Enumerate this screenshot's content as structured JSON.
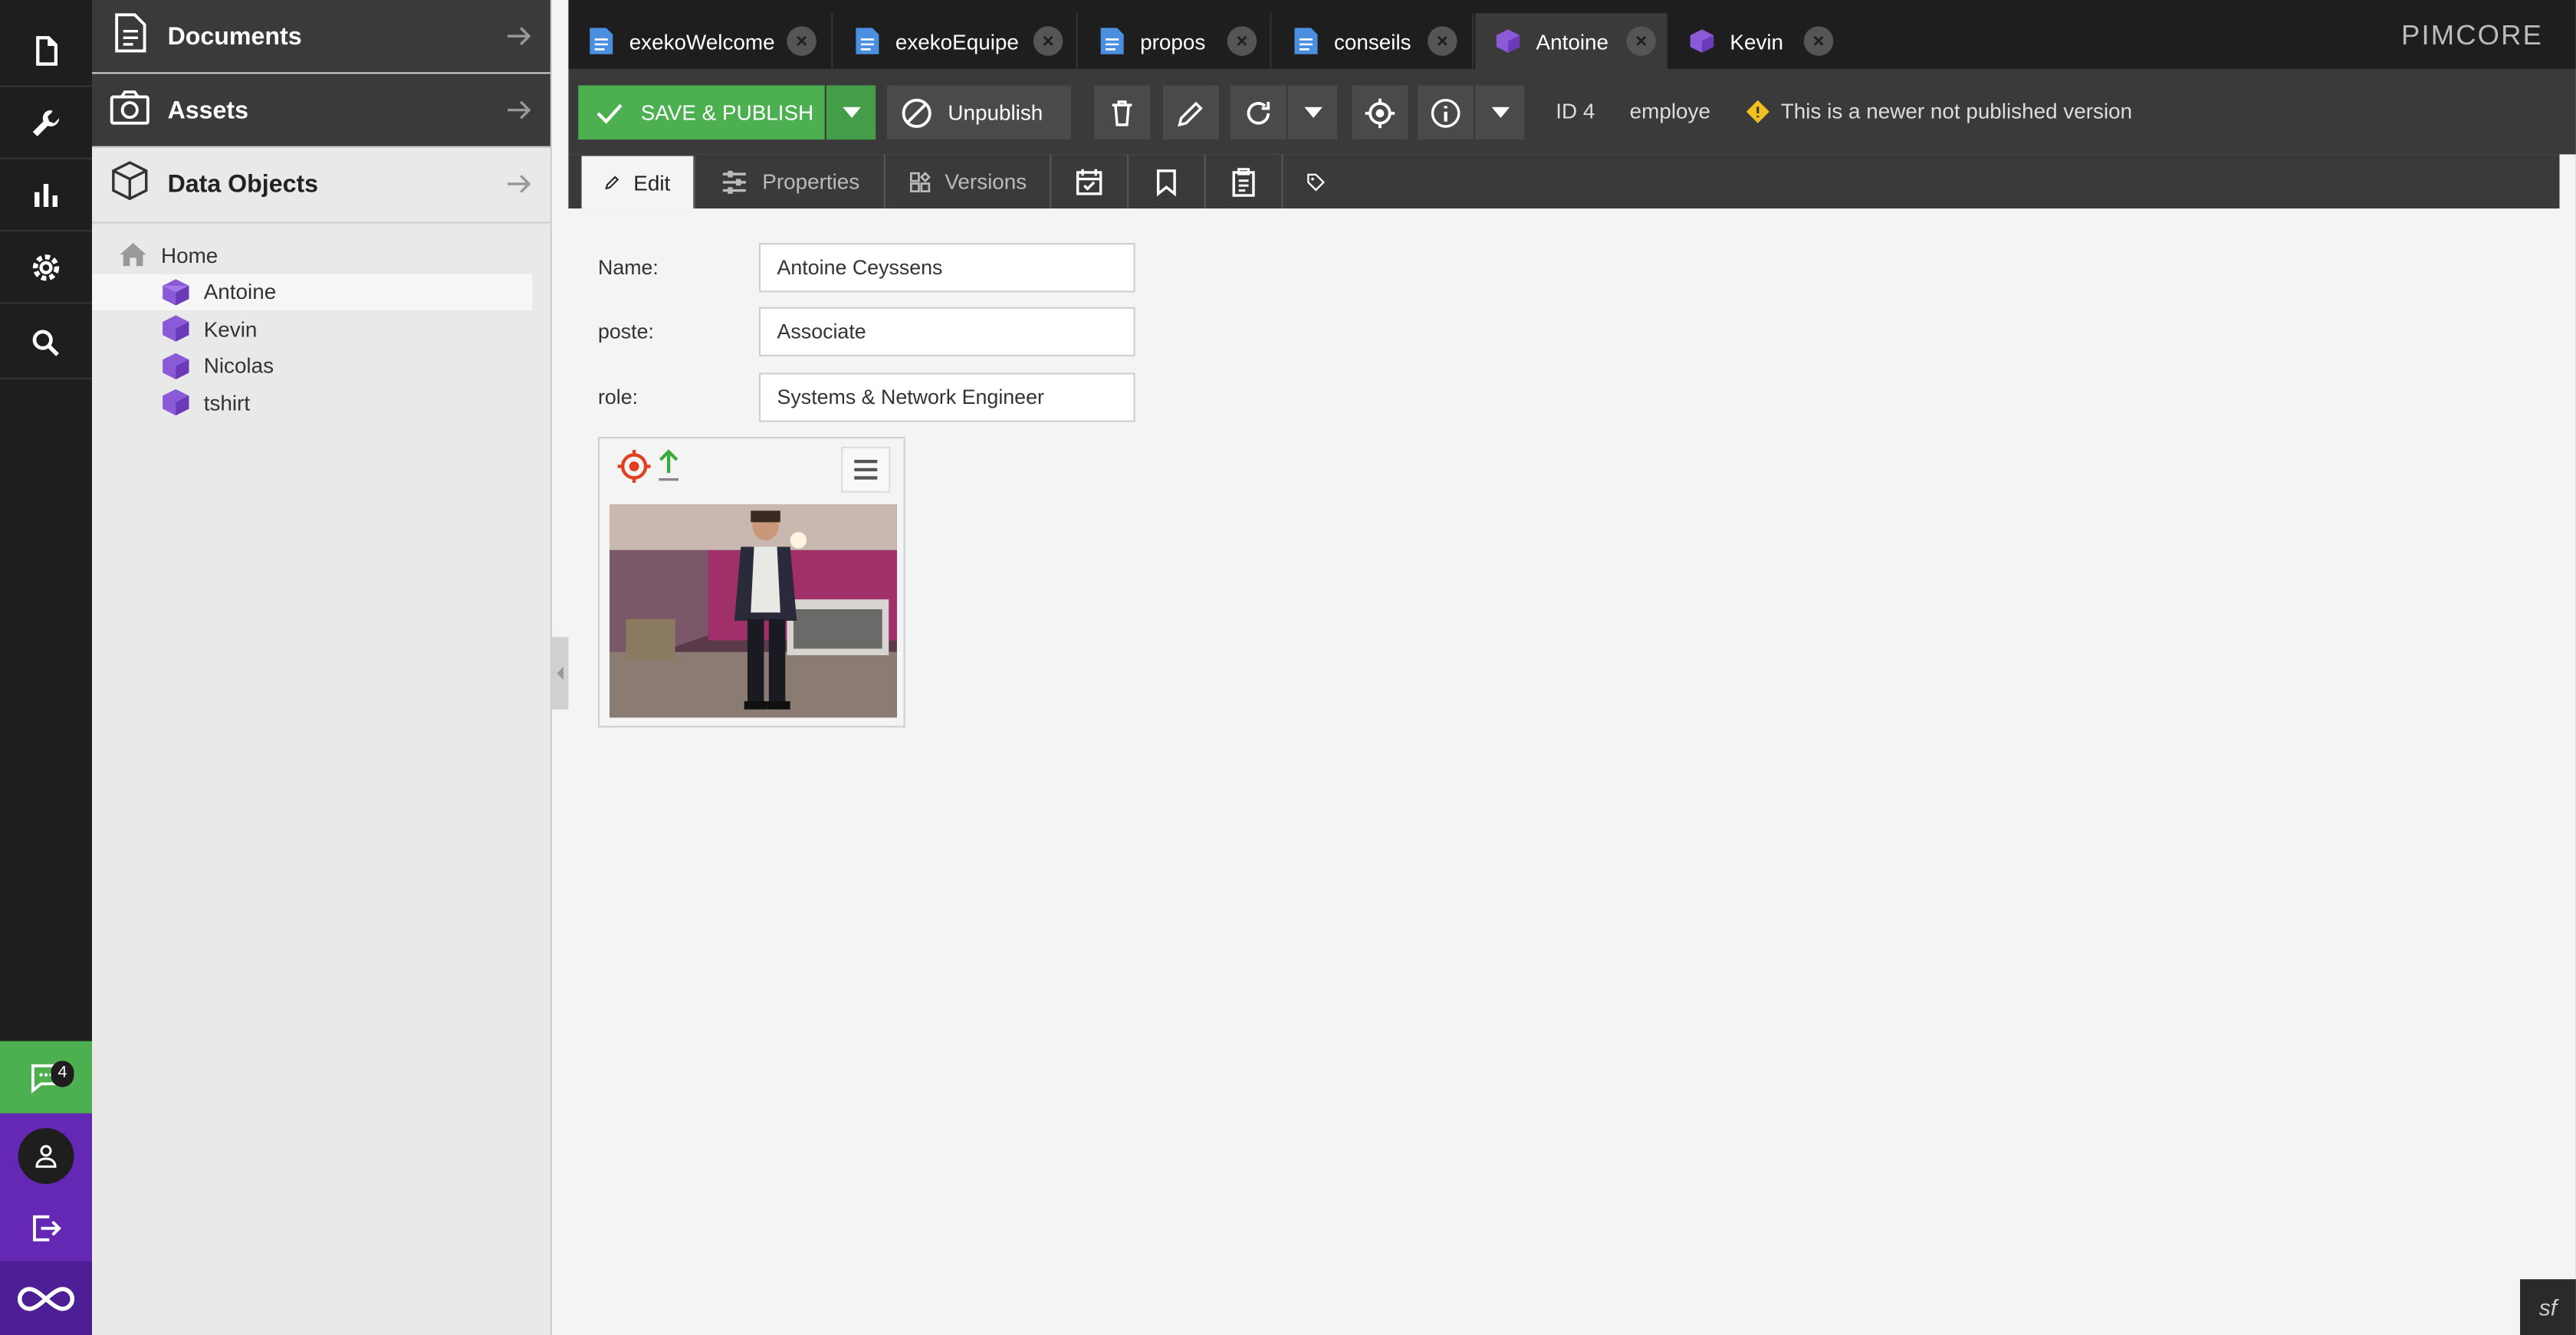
{
  "rail": {
    "items": [
      "document-icon",
      "wrench-icon",
      "chart-icon",
      "gear-icon",
      "search-icon"
    ],
    "notifications_count": "4"
  },
  "tree_panel": {
    "documents_title": "Documents",
    "assets_title": "Assets",
    "data_objects_title": "Data Objects",
    "tree": {
      "root": "Home",
      "children": [
        "Antoine",
        "Kevin",
        "Nicolas",
        "tshirt"
      ],
      "selected": "Antoine"
    }
  },
  "tabs": [
    {
      "label": "exekoWelcome",
      "type": "document"
    },
    {
      "label": "exekoEquipe",
      "type": "document"
    },
    {
      "label": "propos",
      "type": "document"
    },
    {
      "label": "conseils",
      "type": "document"
    },
    {
      "label": "Antoine",
      "type": "object",
      "active": true
    },
    {
      "label": "Kevin",
      "type": "object"
    }
  ],
  "brand": "PIMCORE",
  "toolbar": {
    "save_publish_label": "SAVE & PUBLISH",
    "unpublish_label": "Unpublish",
    "id_label": "ID 4",
    "class_label": "employe",
    "status_message": "This is a newer not published version"
  },
  "subtabs": {
    "edit": "Edit",
    "properties": "Properties",
    "versions": "Versions"
  },
  "form": {
    "name_label": "Name:",
    "name_value": "Antoine Ceyssens",
    "poste_label": "poste:",
    "poste_value": "Associate",
    "role_label": "role:",
    "role_value": "Systems & Network Engineer"
  },
  "colors": {
    "accent_green": "#4caf50",
    "brand_purple": "#6428b4",
    "object_icon": "#8a5ad8",
    "document_icon": "#4a8fe0"
  }
}
